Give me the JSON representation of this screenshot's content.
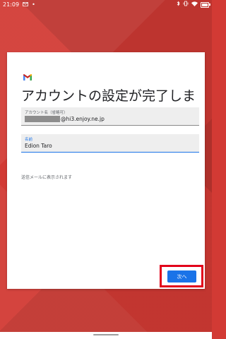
{
  "status_bar": {
    "time": "21:09",
    "left_icons": [
      "gmail-notification-icon",
      "dot-icon"
    ],
    "right_icons": [
      "bluetooth-icon",
      "vibrate-icon",
      "wifi-icon",
      "battery-icon"
    ]
  },
  "setup": {
    "headline": "アカウントの設定が完了しました。",
    "account_field": {
      "label": "アカウント名（省略可）",
      "value_suffix": "@hi3.enjoy.ne.jp"
    },
    "name_field": {
      "label": "名前",
      "value": "Edion Taro"
    },
    "helper_text": "送信メールに表示されます",
    "next_button": "次へ"
  },
  "colors": {
    "background": "#d23a34",
    "accent": "#1a73e8",
    "highlight": "#e2001a"
  }
}
